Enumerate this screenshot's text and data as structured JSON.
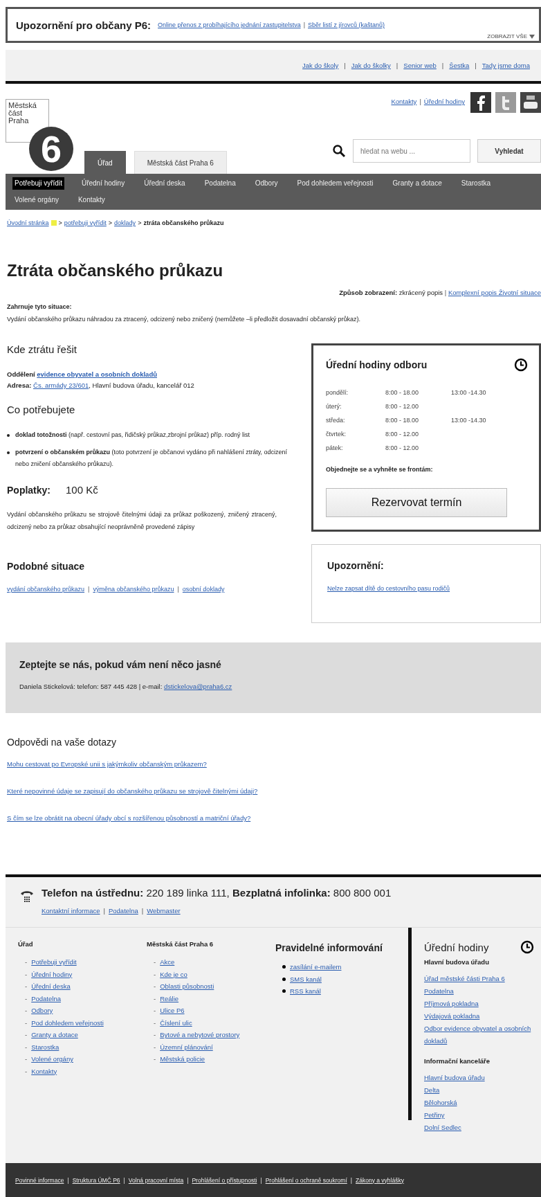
{
  "notice": {
    "label": "Upozornění pro občany P6:",
    "links": [
      "Online přenos z probíhajícího jednání zastupitelstva",
      "Sběr listí z jírovců (kaštanů)"
    ],
    "more": "ZOBRAZIT VŠE",
    "separator": "|"
  },
  "top_links": {
    "items": [
      "Jak do školy",
      "Jak do školky",
      "Senior web",
      "Šestka",
      "Tady jsme doma"
    ],
    "separator": "|"
  },
  "header": {
    "logo_text": "Městská část Praha",
    "logo_number": "6",
    "utility_links": [
      "Kontakty",
      "Úřední hodiny"
    ],
    "utility_separator": "|",
    "search": {
      "placeholder": "hledat na webu ..."
    },
    "search_button": "Vyhledat"
  },
  "tabs": [
    {
      "label": "Úřad",
      "selected": true
    },
    {
      "label": "Městská část Praha 6",
      "selected": false
    }
  ],
  "nav": [
    {
      "label": "Potřebuji vyřídit",
      "selected": true
    },
    {
      "label": "Úřední hodiny",
      "selected": false
    },
    {
      "label": "Úřední deska",
      "selected": false
    },
    {
      "label": "Podatelna",
      "selected": false
    },
    {
      "label": "Odbory",
      "selected": false
    },
    {
      "label": "Pod dohledem veřejnosti",
      "selected": false
    },
    {
      "label": "Granty a dotace",
      "selected": false
    },
    {
      "label": "Starostka",
      "selected": false
    },
    {
      "label": "Volené orgány",
      "selected": false
    },
    {
      "label": "Kontakty",
      "selected": false
    }
  ],
  "breadcrumb": {
    "links": [
      "Úvodní stránka",
      "potřebuji vyřídit",
      "doklady"
    ],
    "current": "ztráta občanského průkazu",
    "separator": ">"
  },
  "title": "Ztráta občanského průkazu",
  "display_mode": {
    "label": "Způsob zobrazení:",
    "current": "zkrácený popis",
    "link": "Komplexní popis Životní situace",
    "separator": "|"
  },
  "includes": {
    "heading": "Zahrnuje tyto situace:",
    "text": "Vydání občanského průkazu náhradou za ztracený, odcizený nebo zničený (nemůžete –li předložit dosavadní občanský průkaz)."
  },
  "where": {
    "heading": "Kde ztrátu řešit",
    "department_label": "Oddělení",
    "department_link": "evidence obyvatel a osobních dokladů",
    "address_label": "Adresa:",
    "address_link": "Čs. armády 23/601",
    "address_rest": ", Hlavní budova úřadu, kancelář 012"
  },
  "needs": {
    "heading": "Co potřebujete",
    "items": [
      "**doklad totožnosti** (např. cestovní pas, řidičský průkaz,zbrojní průkaz) příp. rodný list",
      "**potvrzení o občanském průkazu** (toto potvrzení je občanovi vydáno při nahlášení ztráty, odcizení nebo zničení občanského průkazu)."
    ]
  },
  "fees": {
    "label": "Poplatky:",
    "value": "100 Kč",
    "text": "Vydání občanského průkazu se strojově čitelnými údaji za průkaz poškozený, zničený ztracený, odcizený nebo za průkaz obsahující neoprávněně provedené zápisy"
  },
  "similar": {
    "heading": "Podobné situace",
    "links": [
      "vydání občanského průkazu",
      "výměna občanského průkazu",
      "osobní doklady"
    ],
    "separator": "|"
  },
  "hours": {
    "title": "Úřední hodiny odboru",
    "rows": [
      {
        "day": "pondělí:",
        "morning": "8:00 - 18.00",
        "afternoon": "13:00 -14.30"
      },
      {
        "day": "úterý:",
        "morning": "8:00 - 12.00"
      },
      {
        "day": "středa:",
        "morning": "8:00 - 18.00",
        "afternoon": "13:00 -14.30"
      },
      {
        "day": "čtvrtek:",
        "morning": "8:00 - 12.00"
      },
      {
        "day": "pátek:",
        "morning": "8:00 - 12.00"
      }
    ],
    "note": "Objednejte se a vyhněte se frontám:",
    "button": "Rezervovat termín"
  },
  "warning": {
    "title": "Upozornění:",
    "link": "Nelze zapsat dítě do  cestovního pasu rodičů"
  },
  "ask": {
    "heading": "Zeptejte se nás, pokud vám není něco jasné",
    "text": "Daniela Stickelová: telefon: 587 445 428 | e-mail:",
    "email": "dstickelova@praha6.cz"
  },
  "faq": {
    "heading": "Odpovědi na vaše dotazy",
    "links": [
      "Mohu cestovat po Evropské unii s jakýmkoliv občanským průkazem?",
      "Které nepovinné údaje se zapisují do občanského průkazu se strojově čitelnými údaji?",
      "S čím se lze obrátit na obecní úřady obcí s rozšířenou působností a matriční úřady?"
    ]
  },
  "footer": {
    "phone": "**Telefon na ústřednu:** 220 189 linka 111, **Bezplatná infolinka:** 800 800 001",
    "links": [
      "Kontaktní informace",
      "Podatelna",
      "Webmaster"
    ],
    "link_separator": "|",
    "bottom_separator": "|",
    "columns": [
      {
        "heading": "Úřad",
        "kind": "dash",
        "marker": "-",
        "items": [
          "Potřebuji vyřídit",
          "Úřední hodiny",
          "Úřední deska",
          "Podatelna",
          "Odbory",
          "Pod dohledem veřejnosti",
          "Granty a dotace",
          "Starostka",
          "Volené orgány",
          "Kontakty"
        ]
      },
      {
        "heading": "Městská část Praha 6",
        "kind": "dash",
        "marker": "-",
        "items": [
          "Akce",
          "Kde je co",
          "Oblasti působnosti",
          "Reálie",
          "Ulice P6",
          "Číslení ulic",
          "Bytové a nebytové prostory",
          "Územní plánování",
          "Městská policie"
        ]
      },
      {
        "heading": "Pravidelné informování",
        "kind": "bullet",
        "items": [
          "zasílání e-mailem",
          "SMS kanál",
          "RSS kanál"
        ]
      }
    ],
    "hours": {
      "title": "Úřední hodiny",
      "groups": [
        {
          "heading": "Hlavní budova úřadu",
          "items": [
            "Úřad městské části Praha 6",
            "Podatelna",
            "Příjmová pokladna",
            "Výdajová pokladna",
            "Odbor evidence obyvatel a osobních dokladů"
          ]
        },
        {
          "heading": "Informační kanceláře",
          "items": [
            "Hlavní budova úřadu",
            "Delta",
            "Bělohorská",
            "Petřiny",
            "Dolní Sedlec"
          ]
        }
      ]
    },
    "bottom_links": [
      "Povinné informace",
      "Struktura ÚMČ P6",
      "Volná pracovní místa",
      "Prohlášení o přístupnosti",
      "Prohlášení o ochraně soukromí",
      "Zákony a vyhlášky"
    ]
  }
}
